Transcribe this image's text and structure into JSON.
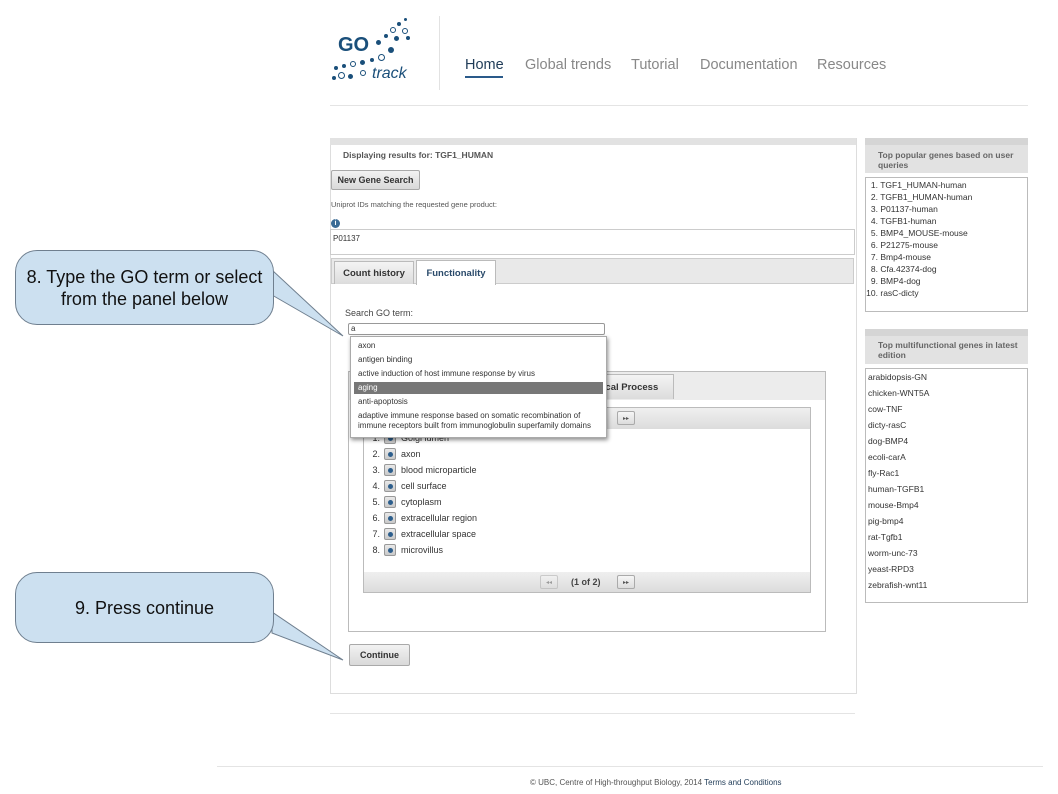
{
  "logo": {
    "text_go": "GO",
    "text_track": "track"
  },
  "nav": {
    "items": [
      "Home",
      "Global trends",
      "Tutorial",
      "Documentation",
      "Resources"
    ],
    "active": "Home"
  },
  "main": {
    "displaying_label": "Displaying results for: TGF1_HUMAN",
    "new_search_label": "New Gene Search",
    "uniprot_label": "Uniprot IDs matching the requested gene product:",
    "uniprot_value": "P01137",
    "tabs": [
      "Count history",
      "Functionality"
    ],
    "search_label": "Search GO term:",
    "search_value": "a",
    "ontology_tab_partial": "ical Process",
    "autocomplete": [
      "axon",
      "antigen binding",
      "active induction of host immune response by virus",
      "aging",
      "anti-apoptosis",
      "adaptive immune response based on somatic recombination of",
      "immune receptors built from immunoglobulin superfamily domains"
    ],
    "autocomplete_highlighted": "aging",
    "terms": [
      {
        "num": "1.",
        "label": "Golgi lumen"
      },
      {
        "num": "2.",
        "label": "axon"
      },
      {
        "num": "3.",
        "label": "blood microparticle"
      },
      {
        "num": "4.",
        "label": "cell surface"
      },
      {
        "num": "5.",
        "label": "cytoplasm"
      },
      {
        "num": "6.",
        "label": "extracellular region"
      },
      {
        "num": "7.",
        "label": "extracellular space"
      },
      {
        "num": "8.",
        "label": "microvillus"
      }
    ],
    "pager_text": "(1 of 2)",
    "pager_prev_icon": "◂◂",
    "pager_next_icon": "▸▸",
    "continue_label": "Continue"
  },
  "side_popular": {
    "title": "Top popular genes based on user queries",
    "items": [
      {
        "num": "1.",
        "label": "TGF1_HUMAN-human"
      },
      {
        "num": "2.",
        "label": "TGFB1_HUMAN-human"
      },
      {
        "num": "3.",
        "label": "P01137-human"
      },
      {
        "num": "4.",
        "label": "TGFB1-human"
      },
      {
        "num": "5.",
        "label": "BMP4_MOUSE-mouse"
      },
      {
        "num": "6.",
        "label": "P21275-mouse"
      },
      {
        "num": "7.",
        "label": "Bmp4-mouse"
      },
      {
        "num": "8.",
        "label": "Cfa.42374-dog"
      },
      {
        "num": "9.",
        "label": "BMP4-dog"
      },
      {
        "num": "10.",
        "label": "rasC-dicty"
      }
    ]
  },
  "side_multi": {
    "title": "Top multifunctional genes in latest edition",
    "items": [
      "arabidopsis-GN",
      "chicken-WNT5A",
      "cow-TNF",
      "dicty-rasC",
      "dog-BMP4",
      "ecoli-carA",
      "fly-Rac1",
      "human-TGFB1",
      "mouse-Bmp4",
      "pig-bmp4",
      "rat-Tgfb1",
      "worm-unc-73",
      "yeast-RPD3",
      "zebrafish-wnt11"
    ]
  },
  "callouts": {
    "step8": "8. Type the GO term or select from the panel below",
    "step9": "9. Press continue"
  },
  "footer": {
    "text": "© UBC, Centre of High-throughput Biology, 2014",
    "link": "Terms and Conditions"
  },
  "colors": {
    "callout_fill": "#cce0f0",
    "brand": "#1a4f7a"
  }
}
